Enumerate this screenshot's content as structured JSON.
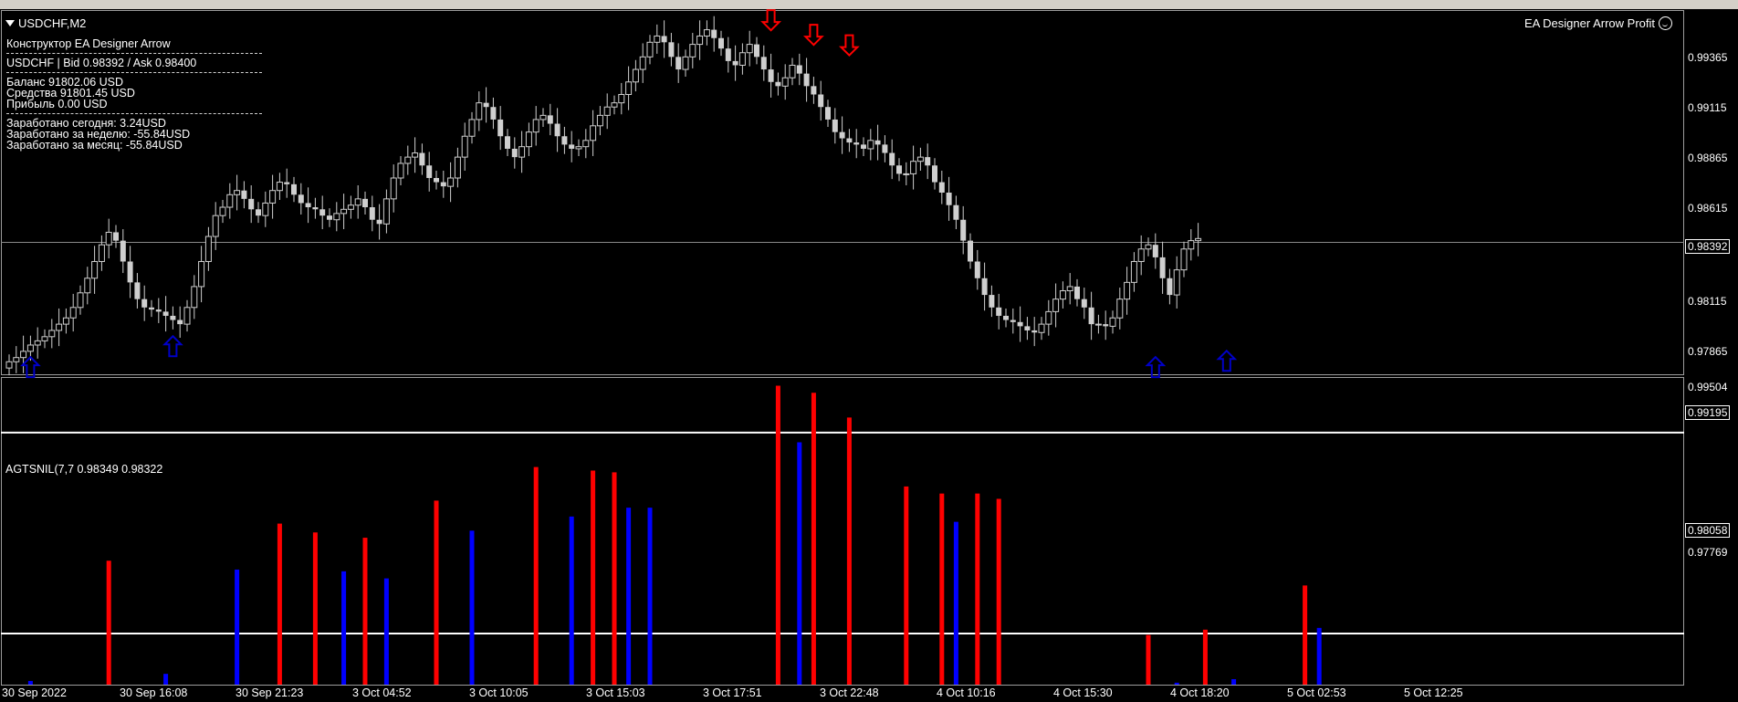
{
  "window": {
    "title": "USDCHF,M2"
  },
  "info_panel": {
    "title": "Конструктор EA Designer Arrow",
    "quote": "USDCHF | Bid 0.98392 / Ask 0.98400",
    "balance": "Баланс 91802.06 USD",
    "equity": "Средства 91801.45 USD",
    "profit": "Прибыль 0.00 USD",
    "earned_today": "Заработано сегодня: 3.24USD",
    "earned_week": "Заработано за неделю: -55.84USD",
    "earned_month": "Заработано за месяц: -55.84USD"
  },
  "ea_label": {
    "name": "EA Designer Arrow Profit",
    "icon": "smiley-icon"
  },
  "price_axis": {
    "labels": [
      "0.99365",
      "0.99115",
      "0.98865",
      "0.98615",
      "0.98115",
      "0.97865"
    ],
    "current_price": "0.98392",
    "ylim": [
      0.9776,
      0.995
    ]
  },
  "indicator": {
    "title": "AGTSNIL(7,7 0.98349 0.98322",
    "axis_labels": [
      "0.99504",
      "0.99195",
      "0.98058",
      "0.97769"
    ],
    "level_upper": 0.99195,
    "level_lower": 0.98058,
    "ylim": [
      0.97769,
      0.99504
    ],
    "up_color": "#ff0000",
    "down_color": "#0000ff"
  },
  "time_axis": {
    "labels": [
      "30 Sep 2022",
      "30 Sep 16:08",
      "30 Sep 21:23",
      "3 Oct 04:52",
      "3 Oct 10:05",
      "3 Oct 15:03",
      "3 Oct 17:51",
      "3 Oct 22:48",
      "4 Oct 10:16",
      "4 Oct 15:30",
      "4 Oct 18:20",
      "5 Oct 02:53",
      "5 Oct 12:25"
    ]
  },
  "chart_data": {
    "type": "candlestick",
    "symbol": "USDCHF",
    "timeframe": "M2",
    "ylim": [
      0.9776,
      0.995
    ],
    "bar_count": 150,
    "price_line": 0.98392,
    "close": [
      0.9782,
      0.9784,
      0.9787,
      0.979,
      0.9792,
      0.9794,
      0.9797,
      0.98,
      0.9803,
      0.9808,
      0.9815,
      0.9822,
      0.983,
      0.9838,
      0.9844,
      0.984,
      0.983,
      0.982,
      0.9812,
      0.9808,
      0.9807,
      0.9806,
      0.9804,
      0.9802,
      0.98,
      0.9808,
      0.9818,
      0.983,
      0.9842,
      0.9852,
      0.9856,
      0.9862,
      0.9864,
      0.986,
      0.9855,
      0.9852,
      0.9858,
      0.9864,
      0.9868,
      0.9867,
      0.9862,
      0.9858,
      0.9856,
      0.9855,
      0.9852,
      0.985,
      0.9853,
      0.9855,
      0.9857,
      0.986,
      0.9856,
      0.985,
      0.9848,
      0.986,
      0.987,
      0.9877,
      0.988,
      0.9882,
      0.9876,
      0.987,
      0.9868,
      0.9866,
      0.987,
      0.988,
      0.989,
      0.9898,
      0.9906,
      0.9904,
      0.9898,
      0.989,
      0.9884,
      0.988,
      0.9885,
      0.9892,
      0.9898,
      0.99,
      0.9896,
      0.989,
      0.9886,
      0.9884,
      0.9885,
      0.9888,
      0.9895,
      0.99,
      0.9904,
      0.9906,
      0.991,
      0.9916,
      0.9922,
      0.9928,
      0.9935,
      0.9938,
      0.9935,
      0.9928,
      0.9922,
      0.9928,
      0.9934,
      0.9938,
      0.9941,
      0.9937,
      0.9932,
      0.9926,
      0.9924,
      0.993,
      0.9934,
      0.9928,
      0.9922,
      0.9916,
      0.9914,
      0.9918,
      0.9924,
      0.992,
      0.9914,
      0.991,
      0.9904,
      0.9898,
      0.9892,
      0.9889,
      0.9887,
      0.9886,
      0.9884,
      0.9888,
      0.9886,
      0.9882,
      0.9876,
      0.9872,
      0.9872,
      0.9878,
      0.988,
      0.9876,
      0.9868,
      0.9863,
      0.9857,
      0.985,
      0.984,
      0.983,
      0.9822,
      0.9814,
      0.9808,
      0.9804,
      0.9802,
      0.9801,
      0.9799,
      0.9797,
      0.9796,
      0.98,
      0.9806,
      0.9812,
      0.9816,
      0.9818,
      0.9812,
      0.9808,
      0.98,
      0.98,
      0.9799,
      0.9803,
      0.9812,
      0.982,
      0.983,
      0.9836,
      0.9838,
      0.9832,
      0.9822,
      0.9814,
      0.9826,
      0.9836,
      0.984,
      0.9841
    ],
    "arrows": [
      {
        "type": "buy",
        "bar": 3,
        "price": 0.9779,
        "color": "#0000c8"
      },
      {
        "type": "buy",
        "bar": 23,
        "price": 0.9789,
        "color": "#0000c8"
      },
      {
        "type": "sell",
        "bar": 107,
        "price": 0.9946,
        "color": "#ff0000"
      },
      {
        "type": "sell",
        "bar": 113,
        "price": 0.9939,
        "color": "#ff0000"
      },
      {
        "type": "sell",
        "bar": 118,
        "price": 0.9934,
        "color": "#ff0000"
      },
      {
        "type": "buy",
        "bar": 161,
        "price": 0.9779,
        "color": "#0000c8"
      },
      {
        "type": "buy",
        "bar": 171,
        "price": 0.9782,
        "color": "#0000c8"
      }
    ],
    "histogram": [
      {
        "bar": 3,
        "dir": "down",
        "value": 0.9779
      },
      {
        "bar": 14,
        "dir": "up",
        "value": 0.9847
      },
      {
        "bar": 22,
        "dir": "down",
        "value": 0.9783
      },
      {
        "bar": 32,
        "dir": "down",
        "value": 0.9842
      },
      {
        "bar": 38,
        "dir": "up",
        "value": 0.9868
      },
      {
        "bar": 43,
        "dir": "up",
        "value": 0.9863
      },
      {
        "bar": 47,
        "dir": "down",
        "value": 0.9841
      },
      {
        "bar": 50,
        "dir": "up",
        "value": 0.986
      },
      {
        "bar": 53,
        "dir": "down",
        "value": 0.9837
      },
      {
        "bar": 60,
        "dir": "up",
        "value": 0.9881
      },
      {
        "bar": 65,
        "dir": "down",
        "value": 0.9864
      },
      {
        "bar": 74,
        "dir": "up",
        "value": 0.99
      },
      {
        "bar": 79,
        "dir": "down",
        "value": 0.9872
      },
      {
        "bar": 82,
        "dir": "up",
        "value": 0.9898
      },
      {
        "bar": 85,
        "dir": "up",
        "value": 0.9897
      },
      {
        "bar": 87,
        "dir": "down",
        "value": 0.9877
      },
      {
        "bar": 90,
        "dir": "down",
        "value": 0.9877
      },
      {
        "bar": 108,
        "dir": "up",
        "value": 0.9946
      },
      {
        "bar": 111,
        "dir": "down",
        "value": 0.9914
      },
      {
        "bar": 113,
        "dir": "up",
        "value": 0.9942
      },
      {
        "bar": 118,
        "dir": "up",
        "value": 0.9928
      },
      {
        "bar": 126,
        "dir": "up",
        "value": 0.9889
      },
      {
        "bar": 131,
        "dir": "up",
        "value": 0.9885
      },
      {
        "bar": 133,
        "dir": "down",
        "value": 0.9869
      },
      {
        "bar": 136,
        "dir": "up",
        "value": 0.9885
      },
      {
        "bar": 139,
        "dir": "up",
        "value": 0.9882
      },
      {
        "bar": 160,
        "dir": "up",
        "value": 0.9805
      },
      {
        "bar": 164,
        "dir": "down",
        "value": 0.9778
      },
      {
        "bar": 168,
        "dir": "up",
        "value": 0.9808
      },
      {
        "bar": 172,
        "dir": "down",
        "value": 0.978
      },
      {
        "bar": 182,
        "dir": "up",
        "value": 0.9833
      },
      {
        "bar": 184,
        "dir": "down",
        "value": 0.9809
      }
    ]
  }
}
